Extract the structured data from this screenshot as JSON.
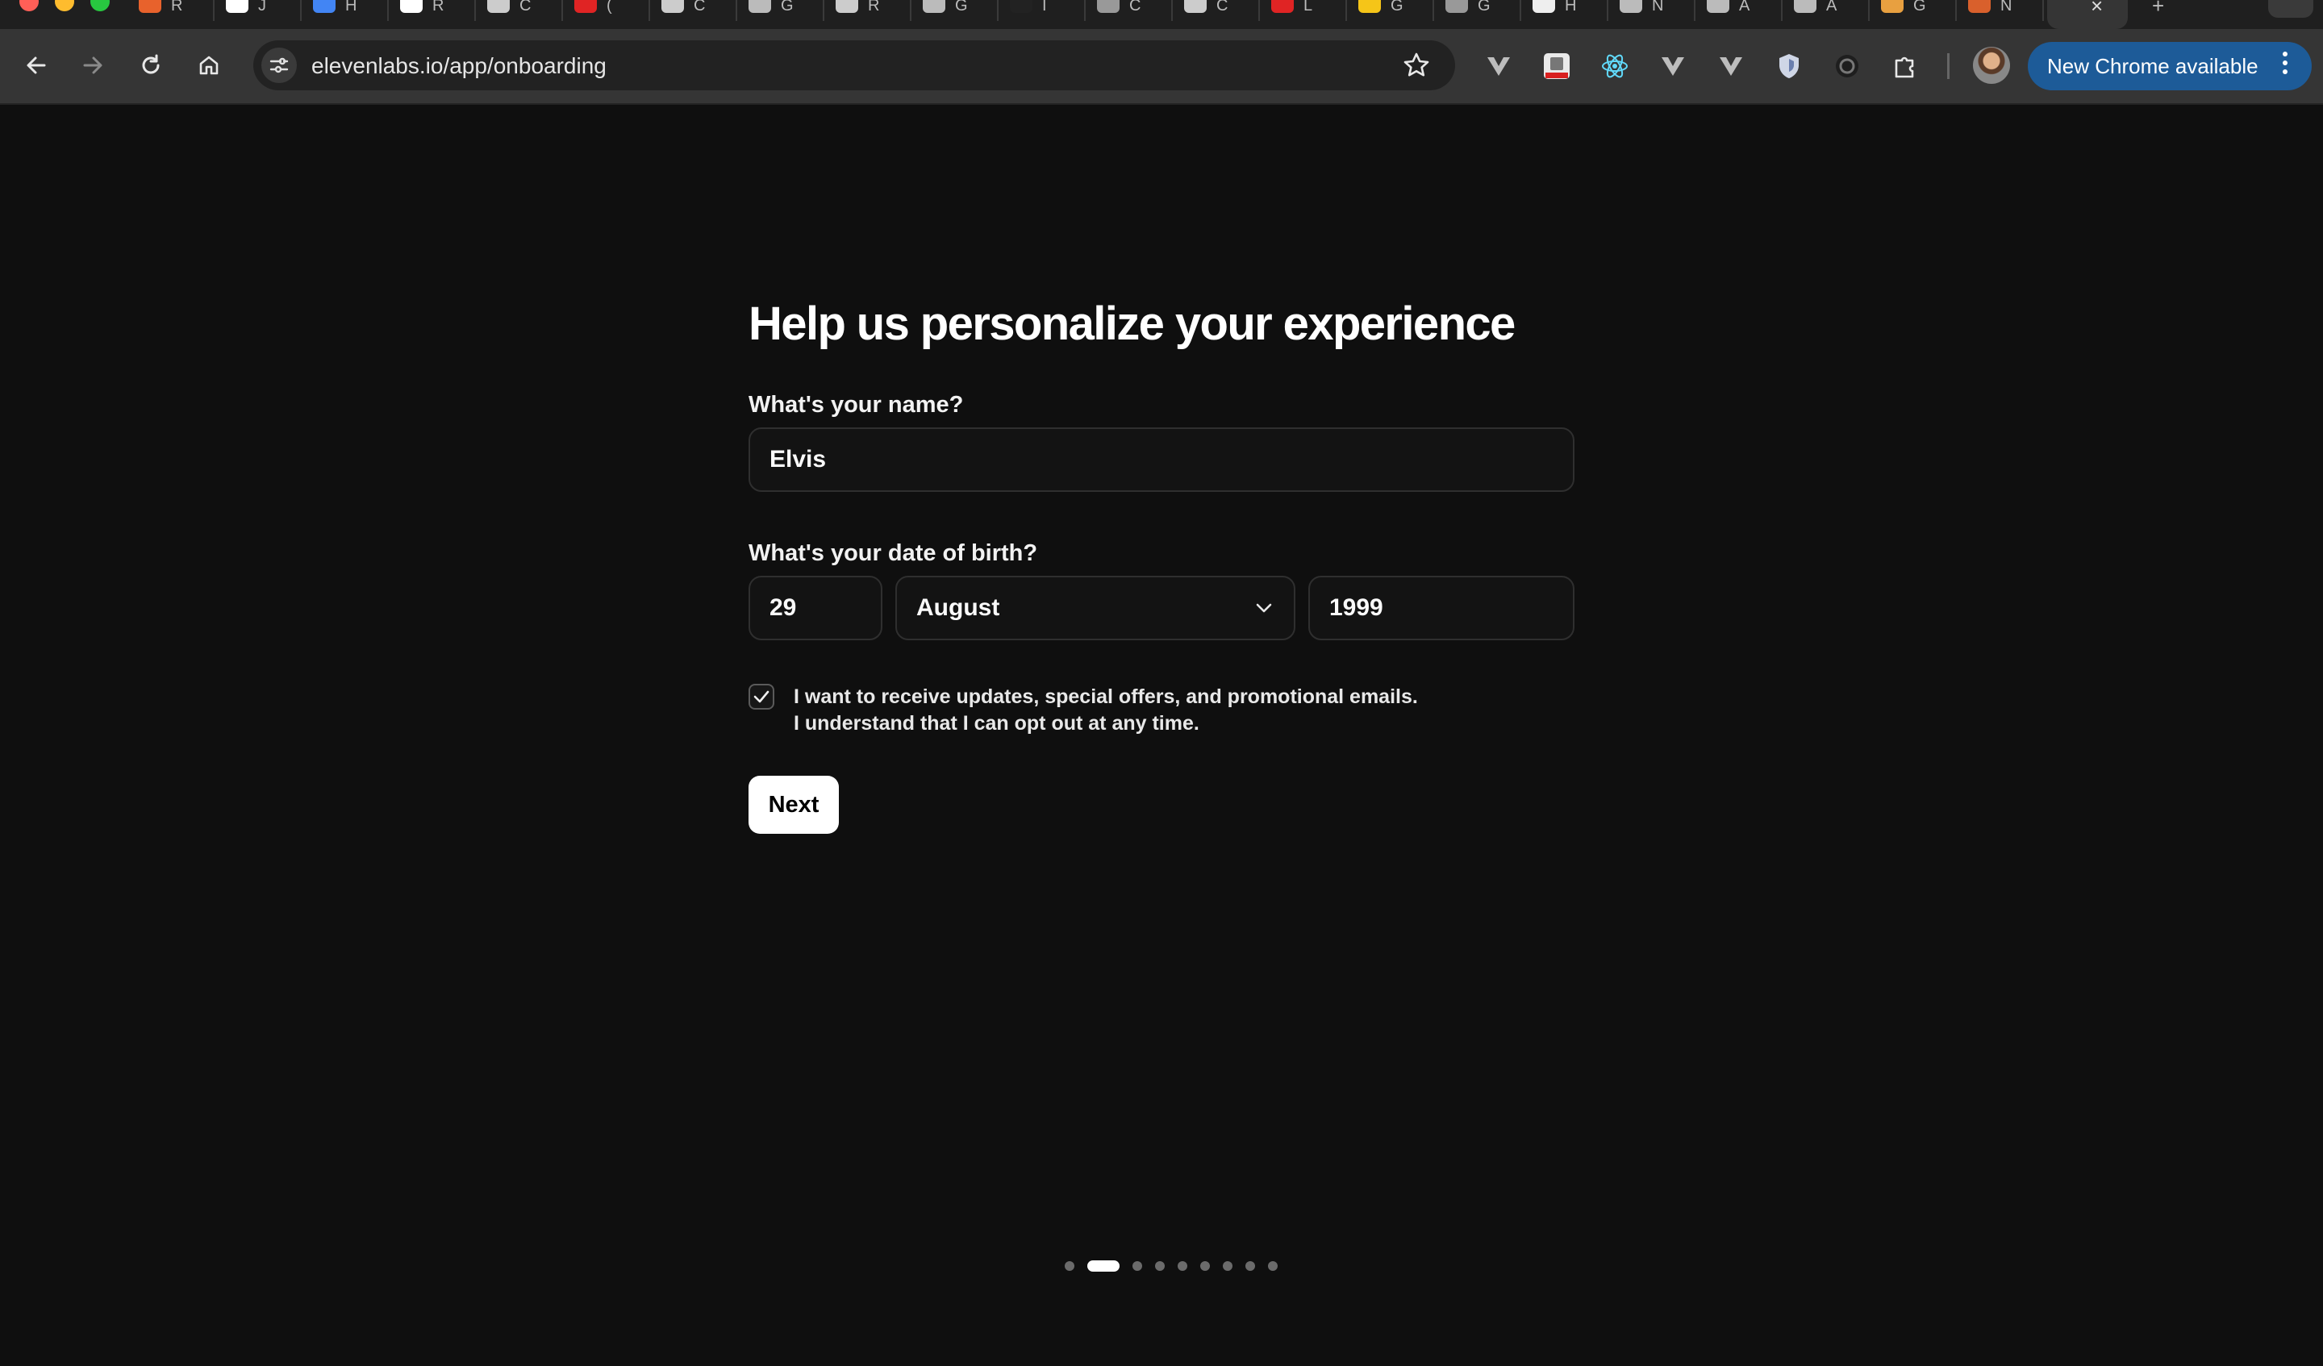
{
  "browser": {
    "tab_glyphs": [
      "R",
      "J",
      "H",
      "R",
      "C",
      "(",
      "C",
      "G",
      "R",
      "G",
      "I",
      "C",
      "C",
      "L",
      "G",
      "G",
      "H",
      "N",
      "A",
      "A",
      "G",
      "N"
    ],
    "address": "elevenlabs.io/app/onboarding",
    "update_button": "New Chrome available",
    "extensions": [
      "vercel-icon",
      "login-icon",
      "react-icon",
      "vercel-icon",
      "vercel-icon",
      "shield-icon",
      "openai-icon",
      "puzzle-icon"
    ]
  },
  "onboarding": {
    "title": "Help us personalize your experience",
    "name_label": "What's your name?",
    "name_value": "Elvis",
    "dob_label": "What's your date of birth?",
    "dob_day": "29",
    "dob_month": "August",
    "dob_year": "1999",
    "consent_checked": true,
    "consent_line1": "I want to receive updates, special offers, and promotional emails.",
    "consent_line2": "I understand that I can opt out at any time.",
    "next_label": "Next"
  },
  "progress": {
    "total_steps": 9,
    "current_step": 2
  },
  "colors": {
    "page_bg": "#0f0f0f",
    "chrome_toolbar": "#353535",
    "update_pill": "#1d5b98",
    "button_bg": "#ffffff"
  }
}
